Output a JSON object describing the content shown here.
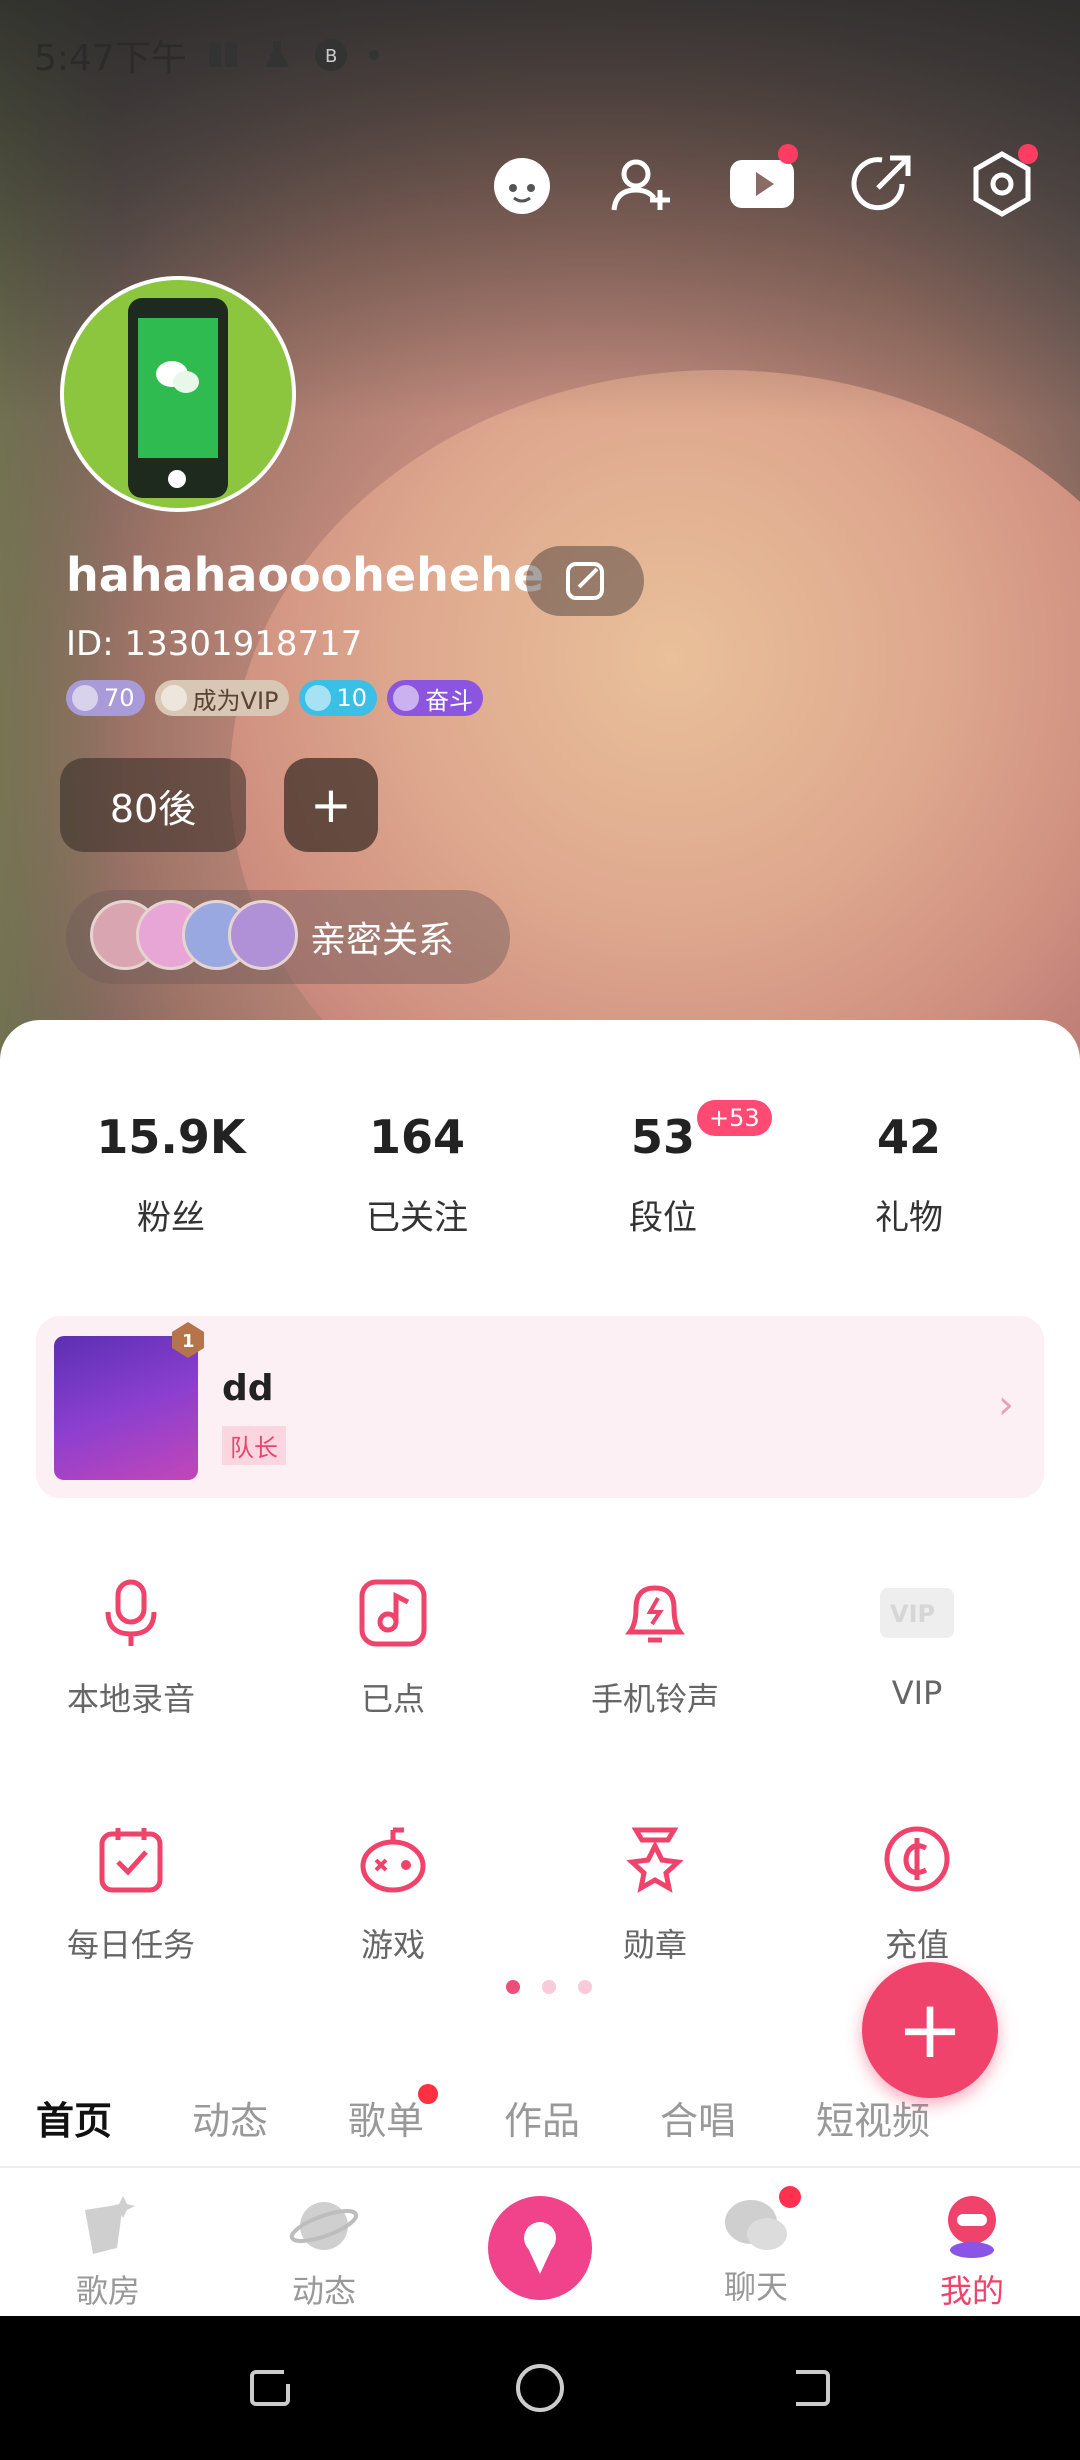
{
  "status_bar": {
    "time": "5:47下午"
  },
  "profile": {
    "username": "hahahaooohehehe",
    "id_text": "ID: 13301918717",
    "badges": [
      {
        "text": "70",
        "color": "#a99bd8"
      },
      {
        "text": "成为VIP",
        "color": "#d8c7b4"
      },
      {
        "text": "10",
        "color": "#3cbfe6"
      },
      {
        "text": "奋斗",
        "color": "#8b55e0"
      }
    ],
    "tag": "80後",
    "add_tag_symbol": "+",
    "intimacy_label": "亲密关系"
  },
  "stats": [
    {
      "value": "15.9K",
      "label": "粉丝"
    },
    {
      "value": "164",
      "label": "已关注"
    },
    {
      "value": "53",
      "label": "段位",
      "delta": "+53"
    },
    {
      "value": "42",
      "label": "礼物"
    }
  ],
  "team": {
    "rank": "1",
    "name": "dd",
    "role": "队长",
    "chevron": "›"
  },
  "features": [
    {
      "label": "本地录音",
      "icon": "microphone-icon"
    },
    {
      "label": "已点",
      "icon": "music-note-icon"
    },
    {
      "label": "手机铃声",
      "icon": "bell-icon"
    },
    {
      "label": "VIP",
      "icon": "vip-icon"
    },
    {
      "label": "每日任务",
      "icon": "calendar-check-icon"
    },
    {
      "label": "游戏",
      "icon": "game-icon"
    },
    {
      "label": "勋章",
      "icon": "medal-icon"
    },
    {
      "label": "充值",
      "icon": "coin-icon"
    }
  ],
  "fab_symbol": "+",
  "tabs": [
    {
      "label": "首页",
      "active": true
    },
    {
      "label": "动态"
    },
    {
      "label": "歌单",
      "dot": true
    },
    {
      "label": "作品"
    },
    {
      "label": "合唱"
    },
    {
      "label": "短视频"
    }
  ],
  "bottom_nav": [
    {
      "label": "歌房"
    },
    {
      "label": "动态"
    },
    {
      "label": "聊天",
      "dot": true
    },
    {
      "label": "我的",
      "active": true
    }
  ],
  "colors": {
    "accent": "#f0436b",
    "notification": "#ff3d62"
  }
}
